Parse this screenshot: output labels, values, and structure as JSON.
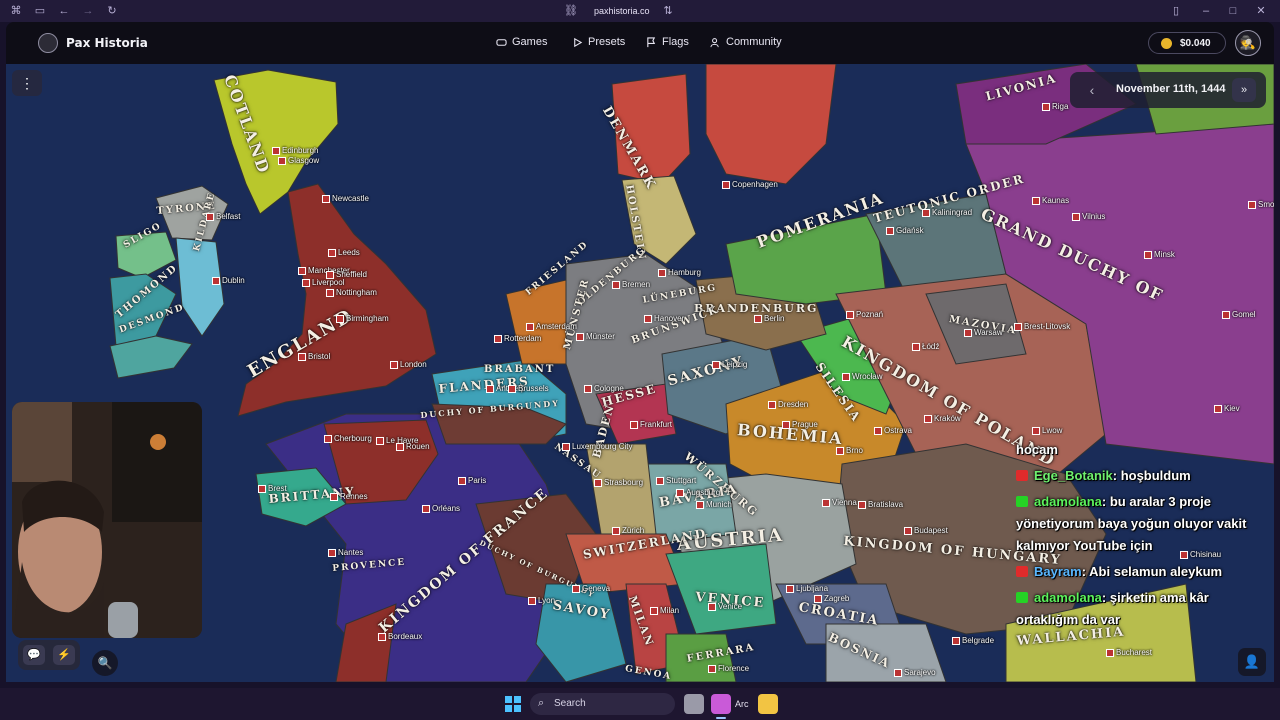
{
  "browser": {
    "url": "paxhistoria.co"
  },
  "header": {
    "brand": "Pax Historia",
    "nav": [
      {
        "label": "Games",
        "icon": "gamepad-icon"
      },
      {
        "label": "Presets",
        "icon": "play-icon"
      },
      {
        "label": "Flags",
        "icon": "flag-icon"
      },
      {
        "label": "Community",
        "icon": "users-icon"
      }
    ],
    "balance": "$0.040"
  },
  "date_panel": {
    "date": "November 11th, 1444"
  },
  "map": {
    "countries": [
      "COTLAND",
      "ENGLAND",
      "TYRONE",
      "SLIGO",
      "THOMOND",
      "DESMOND",
      "KILDARE",
      "DENMARK",
      "HOLSTEIN",
      "POMERANIA",
      "TEUTONIC ORDER",
      "GRAND DUCHY OF",
      "LIVONIA",
      "MAZOVIA",
      "KINGDOM OF POLAND",
      "BRANDENBURG",
      "LÜNEBURG",
      "OLDENBURG",
      "FRIESLAND",
      "MÜNSTER",
      "BRUNSWICK",
      "BRABANT",
      "FLANDERS",
      "DUCHY OF BURGUNDY",
      "HESSE",
      "SAXONY",
      "SILESIA",
      "BOHEMIA",
      "WÜRZBURG",
      "BADEN",
      "BAVARIA",
      "AUSTRIA",
      "KINGDOM OF HUNGARY",
      "NASSAU",
      "BRITTANY",
      "PROVENCE",
      "KINGDOM OF FRANCE",
      "SWITZERLAND",
      "SAVOY",
      "MILAN",
      "VENICE",
      "CROATIA",
      "BOSNIA",
      "FERRARA",
      "GENOA",
      "WALLACHIA",
      "DUCHY OF BURGUNDY"
    ],
    "cities": [
      "Edinburgh",
      "Glasgow",
      "Newcastle",
      "Leeds",
      "Manchester",
      "Sheffield",
      "Liverpool",
      "Nottingham",
      "Birmingham",
      "Dublin",
      "Belfast",
      "Bristol",
      "London",
      "Copenhagen",
      "Hamburg",
      "Bremen",
      "Hanover",
      "Amsterdam",
      "Rotterdam",
      "Antwerp",
      "Brussels",
      "Münster",
      "Cologne",
      "Berlin",
      "Leipzig",
      "Dresden",
      "Prague",
      "Frankfurt",
      "Luxembourg City",
      "Gdańsk",
      "Kaliningrad",
      "Kaunas",
      "Vilnius",
      "Minsk",
      "Riga",
      "Smolensk",
      "Poznań",
      "Warsaw",
      "Łódź",
      "Brest-Litovsk",
      "Gomel",
      "Wrocław",
      "Ostrava",
      "Kraków",
      "Lwow",
      "Kiev",
      "Brno",
      "Vienna",
      "Bratislava",
      "Budapest",
      "Chisinau",
      "Munich",
      "Stuttgart",
      "Augsburg",
      "Strasbourg",
      "Zürich",
      "Geneva",
      "Lyon",
      "Paris",
      "Orléans",
      "Le Havre",
      "Rouen",
      "Cherbourg",
      "Brest",
      "Rennes",
      "Nantes",
      "Bordeaux",
      "Milan",
      "Venice",
      "Ljubljana",
      "Zagreb",
      "Florence",
      "Sarajevo",
      "Belgrade",
      "Bucharest"
    ]
  },
  "chat": {
    "messages": [
      {
        "platform": "youtube",
        "user": "",
        "text": "hocam"
      },
      {
        "platform": "youtube",
        "user": "Ege_Botanik",
        "text": ": hoşbuldum"
      },
      {
        "platform": "kick",
        "user": "adamolana",
        "text": ": bu aralar 3 proje"
      },
      {
        "platform": "",
        "user": "",
        "text": "yönetiyorum baya yoğun oluyor vakit"
      },
      {
        "platform": "",
        "user": "",
        "text": "kalmıyor YouTube için"
      },
      {
        "platform": "youtube",
        "user": "Bayram",
        "text": ": Abi selamun aleykum"
      },
      {
        "platform": "kick",
        "user": "adamolana",
        "text": ": şirketin ama kâr"
      },
      {
        "platform": "",
        "user": "",
        "text": "ortaklığım da var"
      }
    ]
  },
  "taskbar": {
    "search_label": "Search",
    "arc_label": "Arc"
  },
  "colors": {
    "accent": "#e9b52b",
    "header_bg": "#0e0d16",
    "sea": "#1a2c58"
  }
}
